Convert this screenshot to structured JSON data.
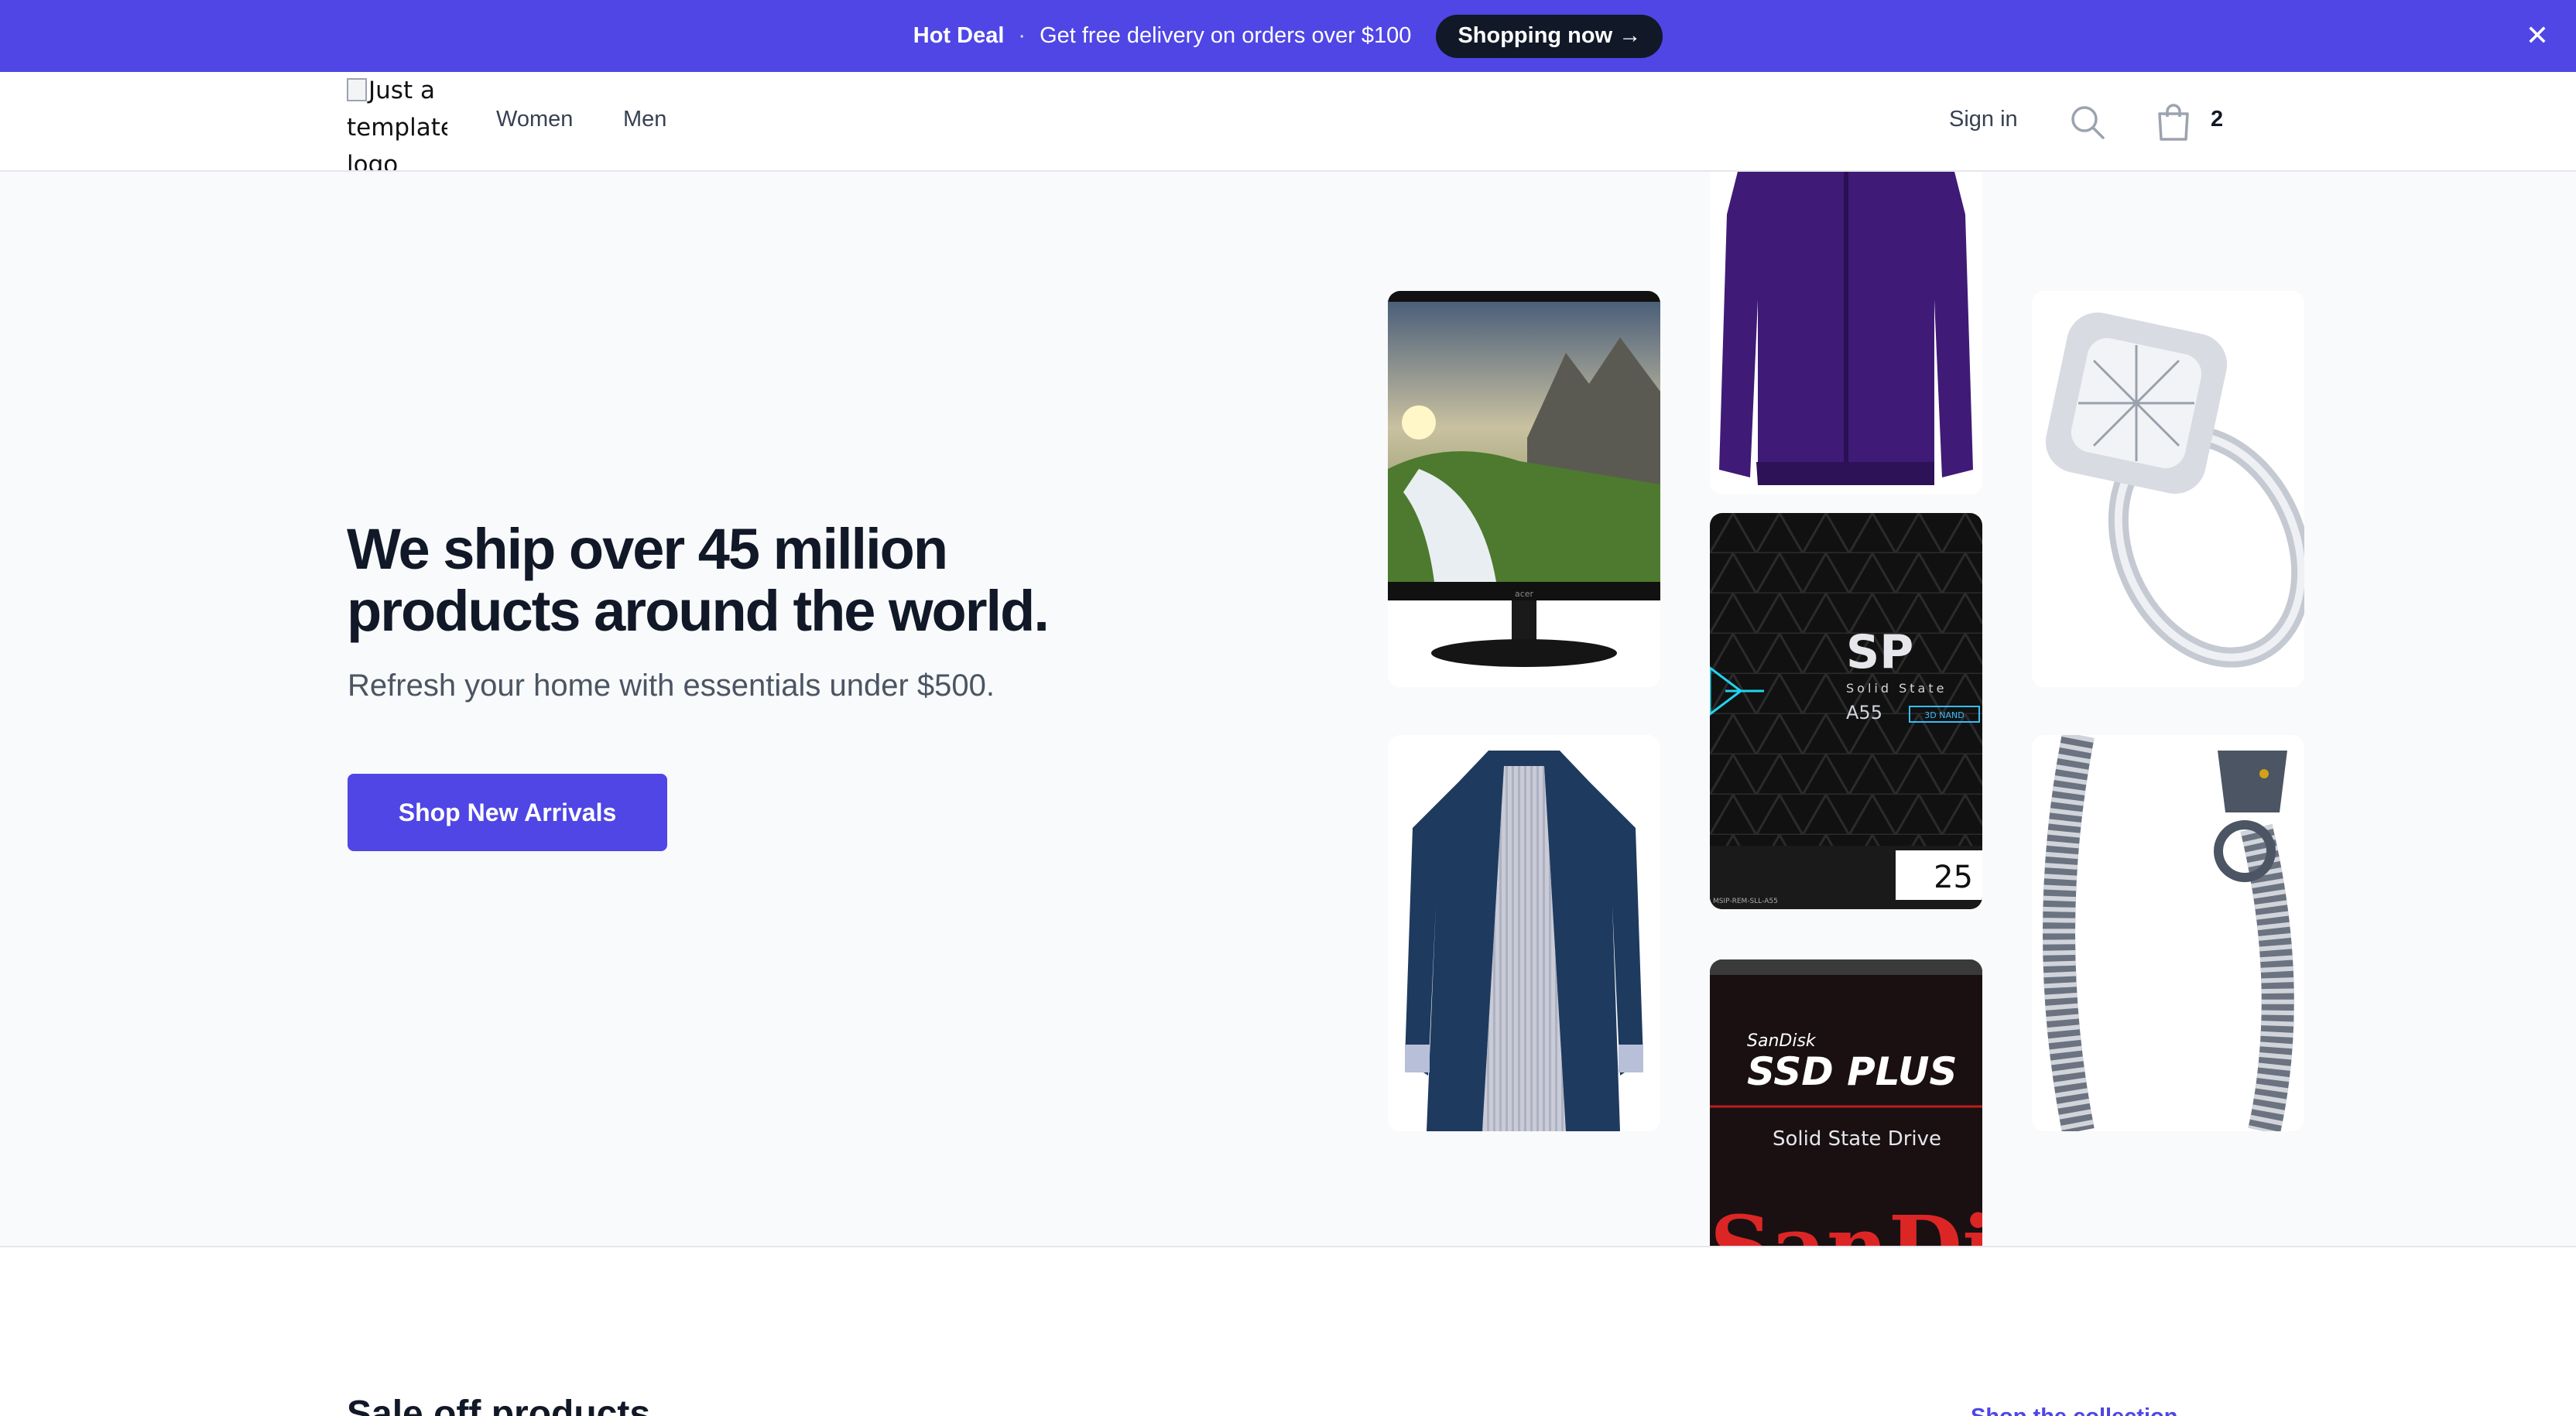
{
  "promo": {
    "hot_label": "Hot Deal",
    "separator": "·",
    "message": "Get free delivery on orders over $100",
    "cta_label": "Shopping now →",
    "close_glyph": "✕"
  },
  "header": {
    "logo_alt": "Just a template logo",
    "nav": [
      "Women",
      "Men"
    ],
    "sign_in": "Sign in",
    "cart_count": "2",
    "icons": [
      "search-icon",
      "shopping-bag-icon"
    ]
  },
  "hero": {
    "title": "We ship over 45 million products around the world.",
    "subtitle": "Refresh your home with essentials under $500.",
    "cta_label": "Shop New Arrivals",
    "tiles": [
      {
        "name": "acer-monitor",
        "printed_text": "acer"
      },
      {
        "name": "navy-trench-coat",
        "printed_text": ""
      },
      {
        "name": "purple-rain-jacket",
        "printed_text": ""
      },
      {
        "name": "silicon-power-ssd",
        "printed_text": "SP",
        "line2": "Solid State",
        "line3": "A55",
        "badge": "3D NAND",
        "capacity": "25",
        "compliance": "MSIP-REM-SLL-A55"
      },
      {
        "name": "sandisk-ssd-plus",
        "brand": "SanDisk",
        "product": "SSD PLUS",
        "subtitle": "Solid State Drive",
        "logo_text": "SanDisk"
      },
      {
        "name": "diamond-ring",
        "printed_text": ""
      },
      {
        "name": "silver-dragon-bracelet",
        "printed_text": ""
      }
    ]
  },
  "section": {
    "title": "Sale off products",
    "link": "Shop the collection"
  },
  "colors": {
    "brand": "#4f46e5",
    "dark": "#111827",
    "hero_bg": "#f9fafb"
  }
}
